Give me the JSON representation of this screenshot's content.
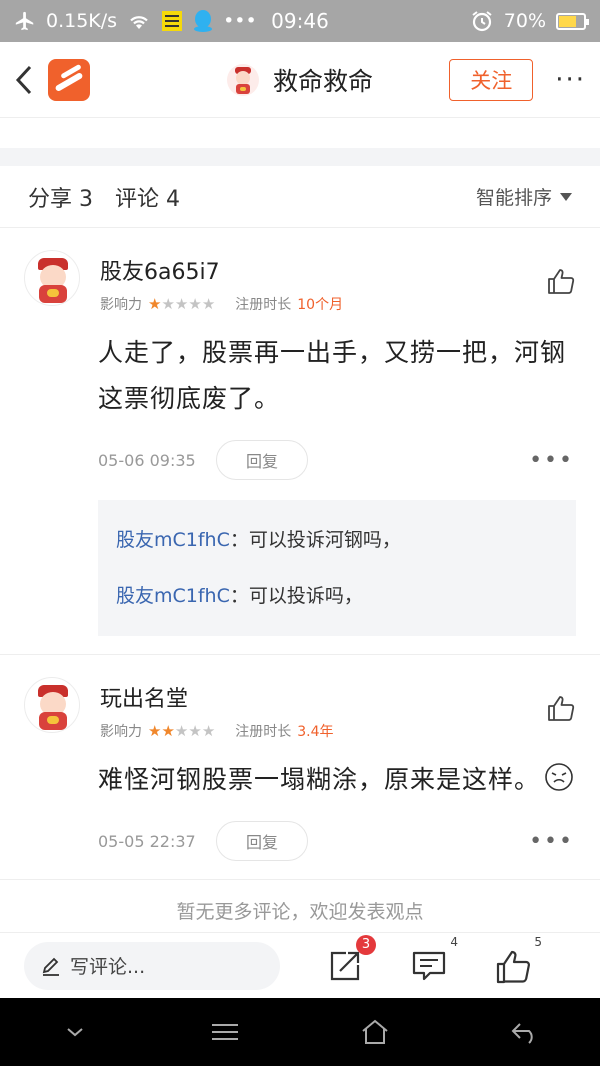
{
  "status_bar": {
    "net_speed": "0.15K/s",
    "time": "09:46",
    "battery": "70%",
    "battery_level": 0.7,
    "icons": [
      "airplane-icon",
      "wifi-icon",
      "notes-icon",
      "qq-icon",
      "more-icon",
      "alarm-icon",
      "battery-charging-icon"
    ]
  },
  "header": {
    "title": "救命救命",
    "follow_label": "关注",
    "more_label": "···"
  },
  "tabs": {
    "share_label": "分享 3",
    "comment_label": "评论 4",
    "sort_label": "智能排序"
  },
  "comments": [
    {
      "user": "股友6a65i7",
      "influence_label": "影响力",
      "stars": 1,
      "reg_label": "注册时长",
      "reg_value": "10个月",
      "text": "人走了，股票再一出手，又捞一把，河钢这票彻底废了。",
      "time": "05-06 09:35",
      "reply_label": "回复",
      "replies": [
        {
          "user": "股友mC1fhC",
          "text": "：可以投诉河钢吗，"
        },
        {
          "user": "股友mC1fhC",
          "text": "：可以投诉吗，"
        }
      ]
    },
    {
      "user": "玩出名堂",
      "influence_label": "影响力",
      "stars": 2,
      "reg_label": "注册时长",
      "reg_value": "3.4年",
      "text": "难怪河钢股票一塌糊涂，原来是这样。",
      "time": "05-05 22:37",
      "reply_label": "回复",
      "replies": []
    }
  ],
  "no_more_text": "暂无更多评论，欢迎发表观点",
  "bottom_bar": {
    "write_placeholder": "写评论...",
    "share_count": "3",
    "comment_count": "4",
    "like_count": "5"
  }
}
